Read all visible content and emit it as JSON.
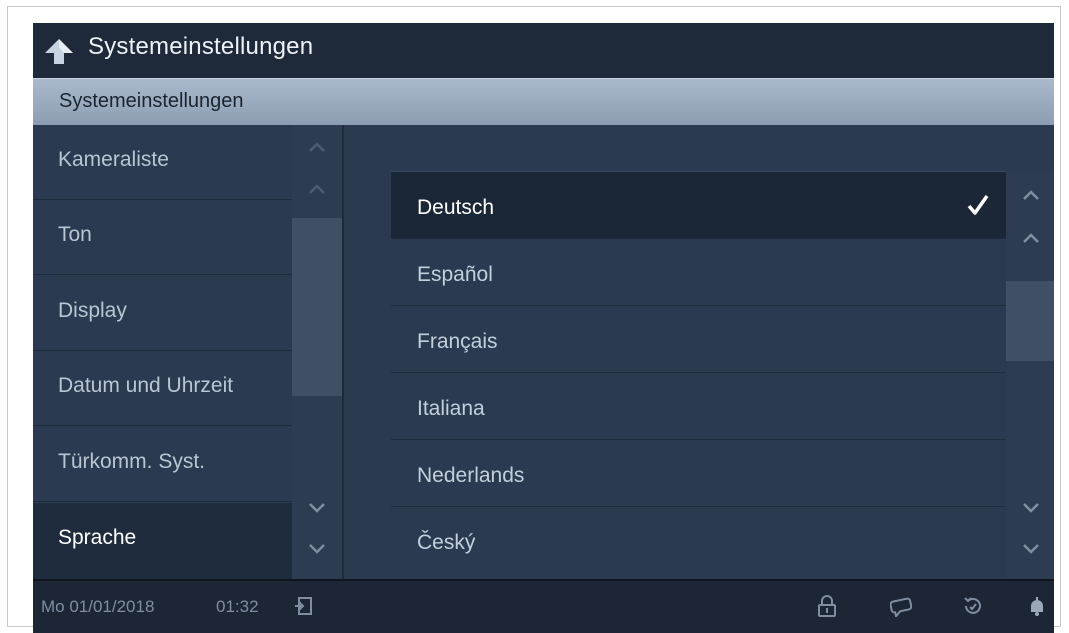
{
  "header": {
    "title": "Systemeinstellungen",
    "back_icon": "up-arrow-icon"
  },
  "subheader": {
    "title": "Systemeinstellungen"
  },
  "menu": {
    "items": [
      {
        "label": "Kameraliste",
        "active": false
      },
      {
        "label": "Ton",
        "active": false
      },
      {
        "label": "Display",
        "active": false
      },
      {
        "label": "Datum und Uhrzeit",
        "active": false
      },
      {
        "label": "Türkomm. Syst.",
        "active": false
      },
      {
        "label": "Sprache",
        "active": true
      }
    ]
  },
  "languages": {
    "items": [
      {
        "label": "Deutsch",
        "selected": true
      },
      {
        "label": "Español",
        "selected": false
      },
      {
        "label": "Français",
        "selected": false
      },
      {
        "label": "Italiana",
        "selected": false
      },
      {
        "label": "Nederlands",
        "selected": false
      },
      {
        "label": "Český",
        "selected": false
      }
    ]
  },
  "footer": {
    "date": "Mo 01/01/2018",
    "time": "01:32",
    "icons": [
      "exit-icon",
      "lock-icon",
      "message-icon",
      "history-icon",
      "bell-icon"
    ]
  },
  "colors": {
    "background": "#2b3a50",
    "header": "#1e2a3a",
    "subheader": "#9aaac0",
    "active_item": "#1b2636",
    "text": "#c3cfdc"
  }
}
